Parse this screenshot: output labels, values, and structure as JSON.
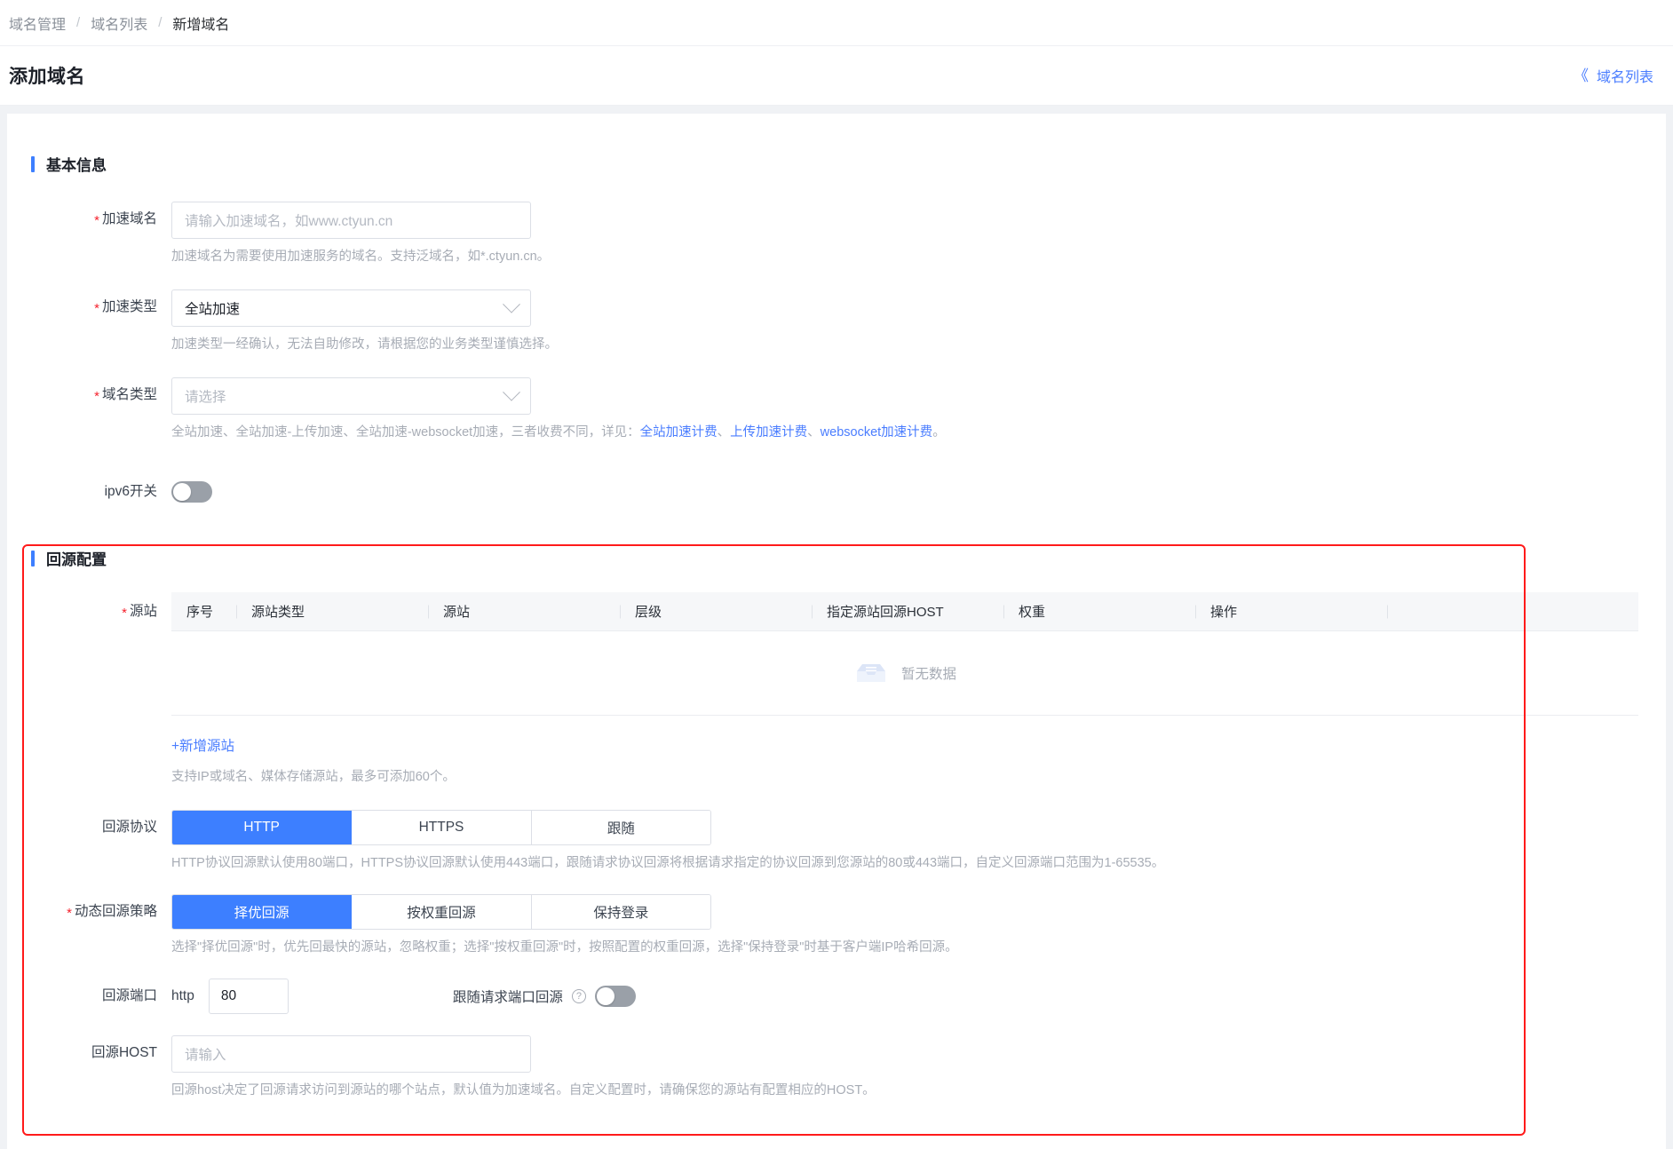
{
  "breadcrumb": {
    "items": [
      "域名管理",
      "域名列表",
      "新增域名"
    ],
    "separator": "/"
  },
  "header": {
    "title": "添加域名",
    "back_link_label": "域名列表",
    "back_icon": "double-chevron-left-icon"
  },
  "basic_section": {
    "title": "基本信息",
    "domain": {
      "label": "加速域名",
      "required": true,
      "value": "",
      "placeholder": "请输入加速域名，如www.ctyun.cn",
      "hint": "加速域名为需要使用加速服务的域名。支持泛域名，如*.ctyun.cn。"
    },
    "accel_type": {
      "label": "加速类型",
      "required": true,
      "value": "全站加速",
      "hint": "加速类型一经确认，无法自助修改，请根据您的业务类型谨慎选择。"
    },
    "domain_type": {
      "label": "域名类型",
      "required": true,
      "value": "请选择",
      "hint_prefix": "全站加速、全站加速-上传加速、全站加速-websocket加速，三者收费不同，详见：",
      "links": [
        "全站加速计费",
        "上传加速计费",
        "websocket加速计费"
      ],
      "link_sep": "、",
      "hint_suffix": "。"
    },
    "ipv6": {
      "label": "ipv6开关",
      "state": "off"
    }
  },
  "origin_section": {
    "title": "回源配置",
    "origin_table": {
      "label": "源站",
      "required": true,
      "columns": [
        "序号",
        "源站类型",
        "源站",
        "层级",
        "指定源站回源HOST",
        "权重",
        "操作"
      ],
      "rows": [],
      "empty_text": "暂无数据",
      "empty_icon": "empty-box-icon",
      "add_link": "+新增源站",
      "hint": "支持IP或域名、媒体存储源站，最多可添加60个。"
    },
    "origin_protocol": {
      "label": "回源协议",
      "options": [
        "HTTP",
        "HTTPS",
        "跟随"
      ],
      "selected": "HTTP",
      "hint": "HTTP协议回源默认使用80端口，HTTPS协议回源默认使用443端口，跟随请求协议回源将根据请求指定的协议回源到您源站的80或443端口，自定义回源端口范围为1-65535。"
    },
    "dynamic_policy": {
      "label": "动态回源策略",
      "required": true,
      "options": [
        "择优回源",
        "按权重回源",
        "保持登录"
      ],
      "selected": "择优回源",
      "hint": "选择\"择优回源\"时，优先回最快的源站，忽略权重；选择\"按权重回源\"时，按照配置的权重回源，选择\"保持登录\"时基于客户端IP哈希回源。"
    },
    "origin_port": {
      "label": "回源端口",
      "protocol_text": "http",
      "value": "80",
      "follow_label": "跟随请求端口回源",
      "follow_help_icon": "question-circle-icon",
      "follow_state": "off"
    },
    "origin_host": {
      "label": "回源HOST",
      "value": "",
      "placeholder": "请输入",
      "hint": "回源host决定了回源请求访问到源站的哪个站点，默认值为加速域名。自定义配置时，请确保您的源站有配置相应的HOST。"
    }
  },
  "colors": {
    "accent": "#3d7fff",
    "link": "#4a7dff",
    "required": "#f5222d",
    "annotation": "#ff1a1a"
  }
}
